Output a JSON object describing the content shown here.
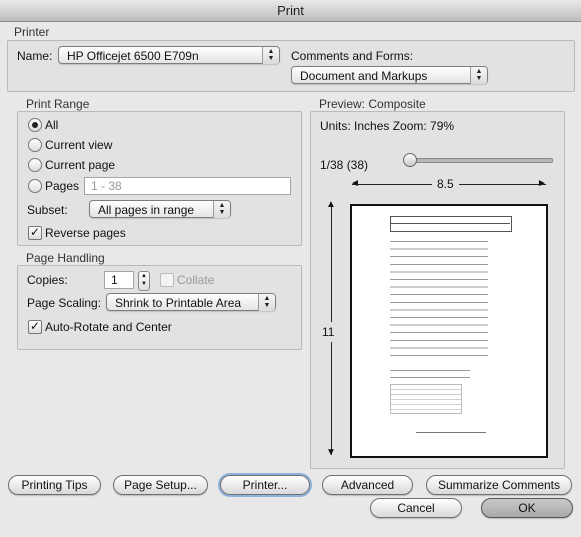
{
  "window": {
    "title": "Print"
  },
  "printer_section": {
    "label": "Printer",
    "name_label": "Name:",
    "printer_name": "HP Officejet 6500 E709n",
    "comments_label": "Comments and Forms:",
    "comments_value": "Document and Markups"
  },
  "print_range": {
    "label": "Print Range",
    "options": [
      "All",
      "Current view",
      "Current page",
      "Pages"
    ],
    "selected": "All",
    "pages_placeholder": "1 - 38",
    "subset_label": "Subset:",
    "subset_value": "All pages in range",
    "reverse_label": "Reverse pages",
    "reverse_checked": true
  },
  "page_handling": {
    "label": "Page Handling",
    "copies_label": "Copies:",
    "copies_value": "1",
    "collate_label": "Collate",
    "scaling_label": "Page Scaling:",
    "scaling_value": "Shrink to Printable Area",
    "autorotate_label": "Auto-Rotate and Center",
    "autorotate_checked": true
  },
  "preview": {
    "label": "Preview: Composite",
    "units_text": "Units: Inches Zoom:  79%",
    "page_counter": "1/38 (38)",
    "width_dim": "8.5",
    "height_dim": "11",
    "slider_position": 0.0
  },
  "buttons": {
    "printing_tips": "Printing Tips",
    "page_setup": "Page Setup...",
    "printer": "Printer...",
    "advanced": "Advanced",
    "summarize": "Summarize Comments",
    "cancel": "Cancel",
    "ok": "OK"
  },
  "icons": {
    "popup_arrows": "up-down-chevron-icon",
    "checkmark": "checkmark-icon",
    "stepper": "stepper-arrows-icon"
  }
}
